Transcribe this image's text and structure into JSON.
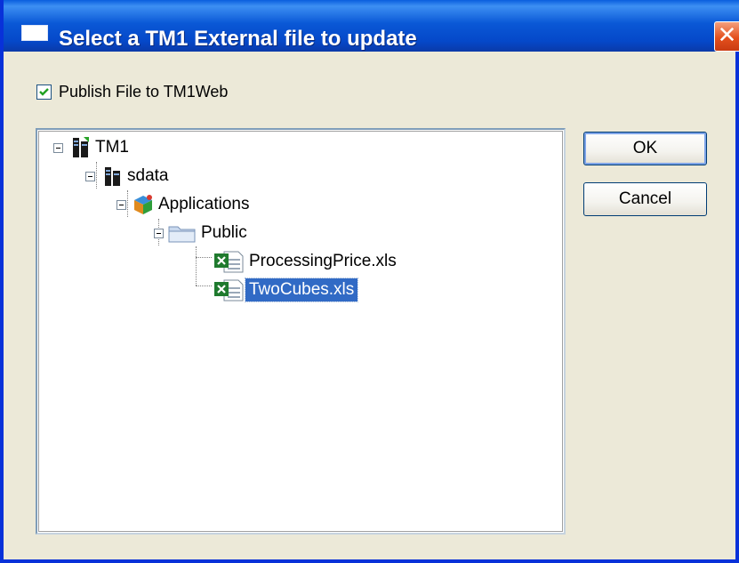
{
  "window": {
    "title": "Select a TM1 External file to update",
    "close_glyph": "✕"
  },
  "publish_checkbox": {
    "label": "Publish File to TM1Web",
    "checked": true
  },
  "tree": {
    "nodes": [
      {
        "label": "TM1",
        "icon": "server-icon",
        "level": 0,
        "expanded": true
      },
      {
        "label": "sdata",
        "icon": "server-icon",
        "level": 1,
        "expanded": true
      },
      {
        "label": "Applications",
        "icon": "applications-icon",
        "level": 2,
        "expanded": true
      },
      {
        "label": "Public",
        "icon": "folder-icon",
        "level": 3,
        "expanded": true
      },
      {
        "label": "ProcessingPrice.xls",
        "icon": "excel-file-icon",
        "level": 4,
        "selected": false
      },
      {
        "label": "TwoCubes.xls",
        "icon": "excel-file-icon",
        "level": 4,
        "selected": true
      }
    ]
  },
  "buttons": {
    "ok_label": "OK",
    "cancel_label": "Cancel"
  },
  "colors": {
    "title_bar": "#0a58d6",
    "selection": "#316ac5",
    "close_button": "#e4501d",
    "dialog_bg": "#ece9d8"
  }
}
